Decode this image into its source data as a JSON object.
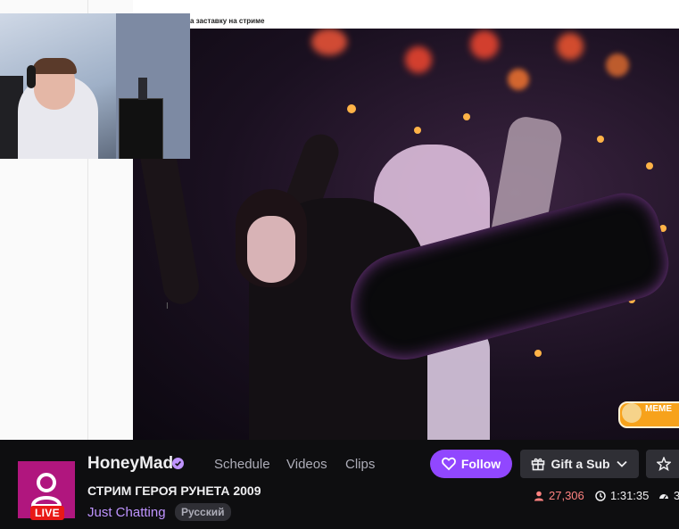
{
  "stream": {
    "doc_text": "а заставку на стриме",
    "overlay_badge": "MEME",
    "cursor_glyph": "I"
  },
  "channel": {
    "name": "HoneyMad",
    "live_label": "LIVE",
    "title": "СТРИМ ГЕРОЯ РУНЕТА 2009",
    "category": "Just Chatting",
    "language": "Русский",
    "avatar_color": "#b0167e"
  },
  "nav": {
    "schedule": "Schedule",
    "videos": "Videos",
    "clips": "Clips"
  },
  "actions": {
    "follow_label": "Follow",
    "gift_label": "Gift a Sub"
  },
  "stats": {
    "viewers": "27,306",
    "uptime": "1:31:35",
    "extra": "3"
  },
  "colors": {
    "accent": "#9147ff",
    "live": "#e91916",
    "viewer_count": "#ff8280",
    "category_link": "#bf94ff"
  }
}
